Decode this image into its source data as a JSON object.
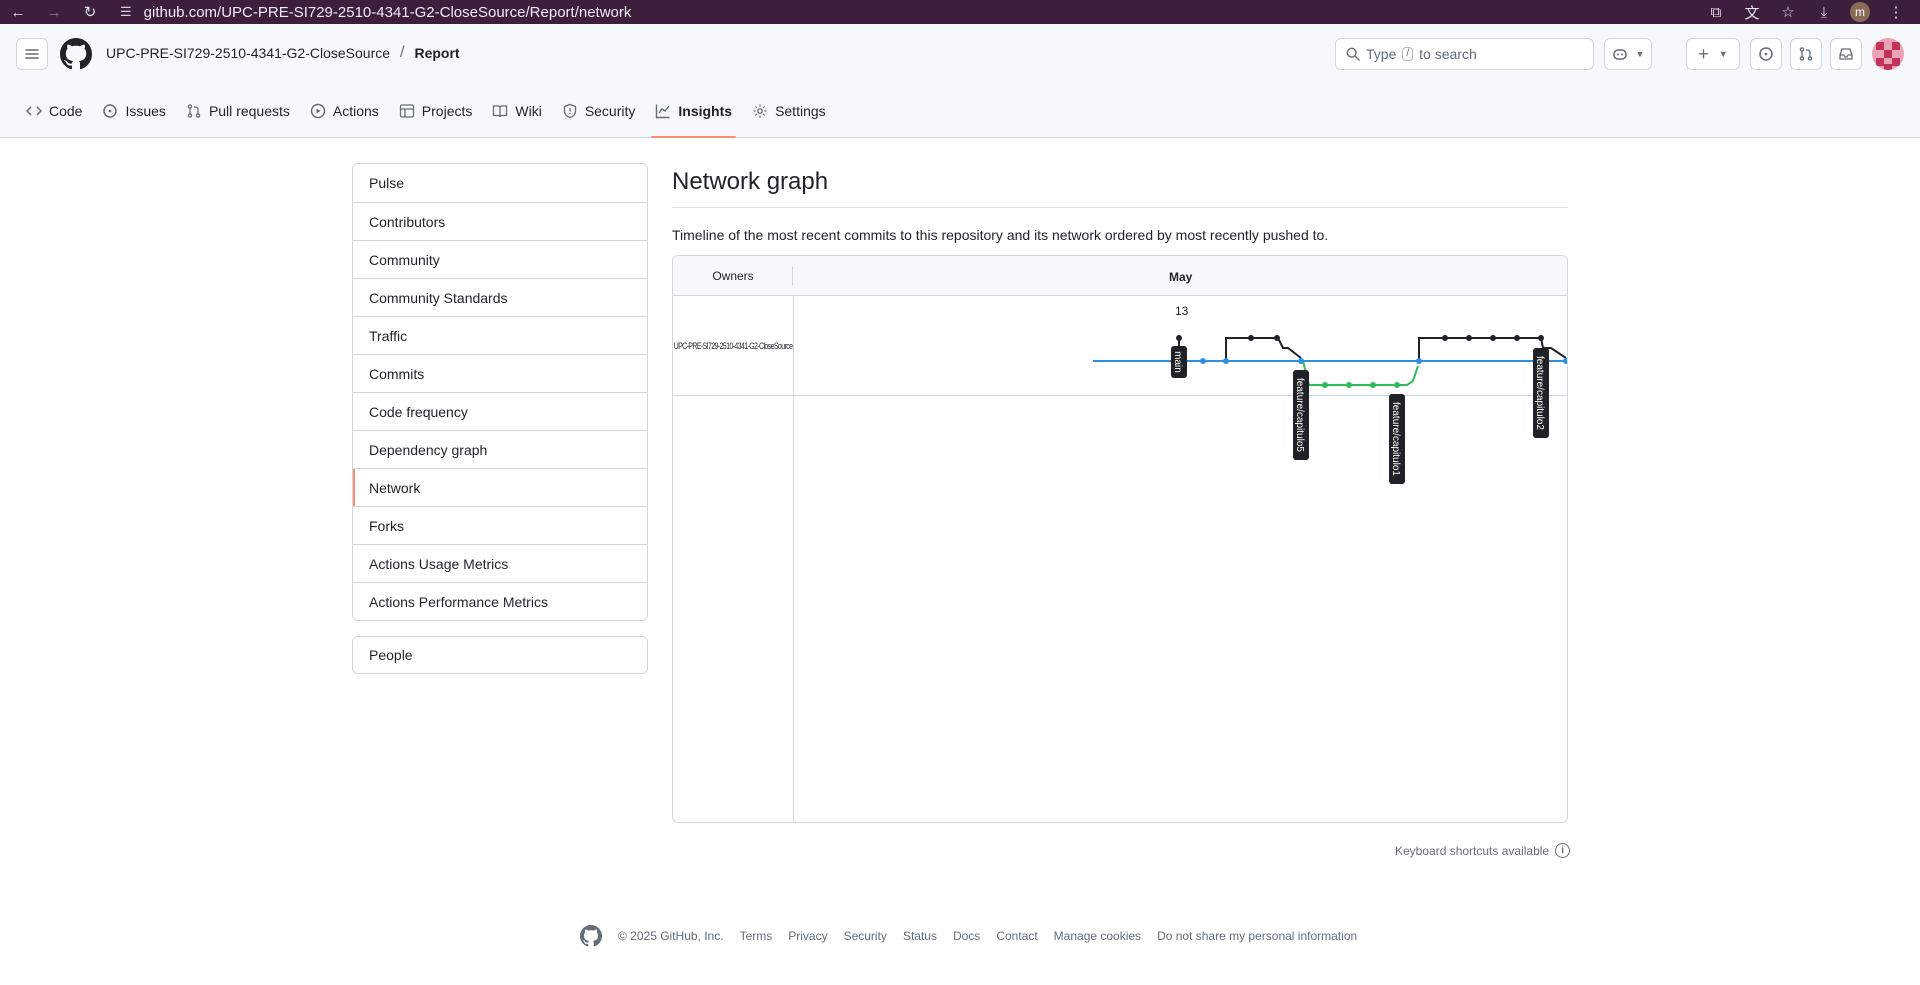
{
  "browser": {
    "url": "github.com/UPC-PRE-SI729-2510-4341-G2-CloseSource/Report/network",
    "profile_initial": "m"
  },
  "header": {
    "owner": "UPC-PRE-SI729-2510-4341-G2-CloseSource",
    "separator": "/",
    "repo": "Report",
    "search_prefix": "Type",
    "search_key": "/",
    "search_suffix": "to search"
  },
  "repo_nav": [
    {
      "label": "Code",
      "icon": "code-icon"
    },
    {
      "label": "Issues",
      "icon": "issue-icon"
    },
    {
      "label": "Pull requests",
      "icon": "pull-request-icon"
    },
    {
      "label": "Actions",
      "icon": "play-icon"
    },
    {
      "label": "Projects",
      "icon": "table-icon"
    },
    {
      "label": "Wiki",
      "icon": "book-icon"
    },
    {
      "label": "Security",
      "icon": "shield-icon"
    },
    {
      "label": "Insights",
      "icon": "graph-icon",
      "active": true
    },
    {
      "label": "Settings",
      "icon": "gear-icon"
    }
  ],
  "sidebar": {
    "items": [
      "Pulse",
      "Contributors",
      "Community",
      "Community Standards",
      "Traffic",
      "Commits",
      "Code frequency",
      "Dependency graph",
      "Network",
      "Forks",
      "Actions Usage Metrics",
      "Actions Performance Metrics"
    ],
    "selected": "Network",
    "people": "People"
  },
  "main": {
    "title": "Network graph",
    "description": "Timeline of the most recent commits to this repository and its network ordered by most recently pushed to."
  },
  "network": {
    "owners_label": "Owners",
    "month": "May",
    "day": "13",
    "owner_name": "UPC-PRE-SI729-2510-4341-G2-CloseSource",
    "branches": [
      "main",
      "feature/capitulo5",
      "feature/capitulo1",
      "feature/capitulo2"
    ],
    "colors": {
      "main": "#1f2328",
      "blue": "#2f8fdf",
      "green": "#2dbd5b"
    }
  },
  "keyboard_hint": "Keyboard shortcuts available",
  "footer": {
    "copyright": "© 2025 GitHub, Inc.",
    "links": [
      "Terms",
      "Privacy",
      "Security",
      "Status",
      "Docs",
      "Contact",
      "Manage cookies",
      "Do not share my personal information"
    ]
  }
}
